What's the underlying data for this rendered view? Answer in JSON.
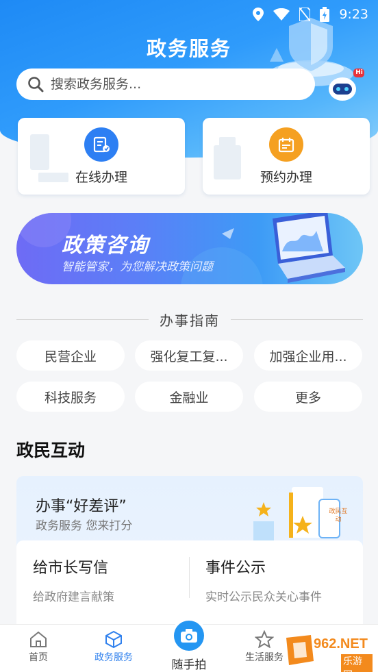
{
  "status_bar": {
    "time": "9:23"
  },
  "header": {
    "title": "政务服务"
  },
  "search": {
    "placeholder": "搜索政务服务..."
  },
  "robot": {
    "badge": "Hi"
  },
  "quick_actions": [
    {
      "label": "在线办理",
      "icon": "document-edit-icon",
      "color": "#2d7ff3"
    },
    {
      "label": "预约办理",
      "icon": "calendar-icon",
      "color": "#f5a021"
    }
  ],
  "banner": {
    "title": "政策咨询",
    "subtitle": "智能管家，为您解决政策问题"
  },
  "guide": {
    "title": "办事指南",
    "chips": [
      "民营企业",
      "强化复工复...",
      "加强企业用...",
      "科技服务",
      "金融业",
      "更多"
    ]
  },
  "interaction": {
    "section_title": "政民互动",
    "rating_title": "办事“好差评”",
    "rating_subtitle": "政务服务  您来打分",
    "illus_tag": "政民互动",
    "items": [
      {
        "title": "给市长写信",
        "subtitle": "给政府建言献策"
      },
      {
        "title": "事件公示",
        "subtitle": "实时公示民众关心事件"
      }
    ]
  },
  "tabbar": {
    "tabs": [
      {
        "label": "首页",
        "icon": "home-icon"
      },
      {
        "label": "政务服务",
        "icon": "cube-icon",
        "active": true
      },
      {
        "label": "随手拍",
        "icon": "camera-icon"
      },
      {
        "label": "生活服务",
        "icon": "star-icon"
      }
    ]
  },
  "watermark": {
    "text": "962.NET",
    "sub": "乐游网"
  },
  "colors": {
    "primary": "#2496f2",
    "active_tab": "#2f80ed",
    "accent_orange": "#f5a021"
  }
}
